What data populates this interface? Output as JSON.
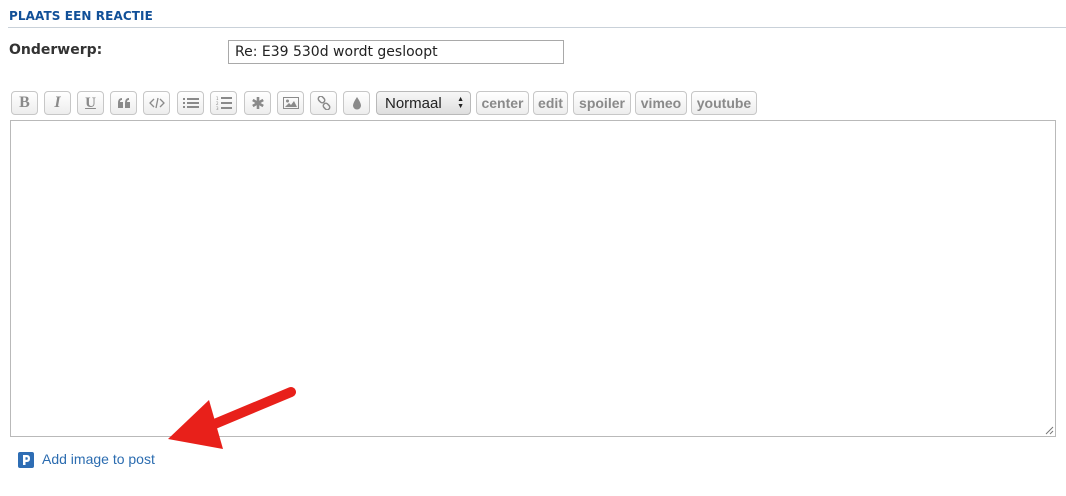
{
  "section": {
    "title": "PLAATS EEN REACTIE"
  },
  "form": {
    "subject_label": "Onderwerp:",
    "subject_value": "Re: E39 530d wordt gesloopt"
  },
  "toolbar": {
    "bold_label": "B",
    "italic_label": "I",
    "underline_label": "U",
    "font_size_value": "Normaal",
    "center_label": "center",
    "edit_label": "edit",
    "spoiler_label": "spoiler",
    "vimeo_label": "vimeo",
    "youtube_label": "youtube",
    "icons": [
      "bold-icon",
      "italic-icon",
      "underline-icon",
      "quote-icon",
      "code-icon",
      "list-icon",
      "numbered-list-icon",
      "asterisk-icon",
      "image-icon",
      "link-icon",
      "color-drop-icon"
    ]
  },
  "editor": {
    "content": ""
  },
  "footer": {
    "add_image_label": "Add image to post"
  },
  "colors": {
    "accent": "#115098",
    "link": "#2b6cb0",
    "annotation_arrow": "#e8201a"
  }
}
